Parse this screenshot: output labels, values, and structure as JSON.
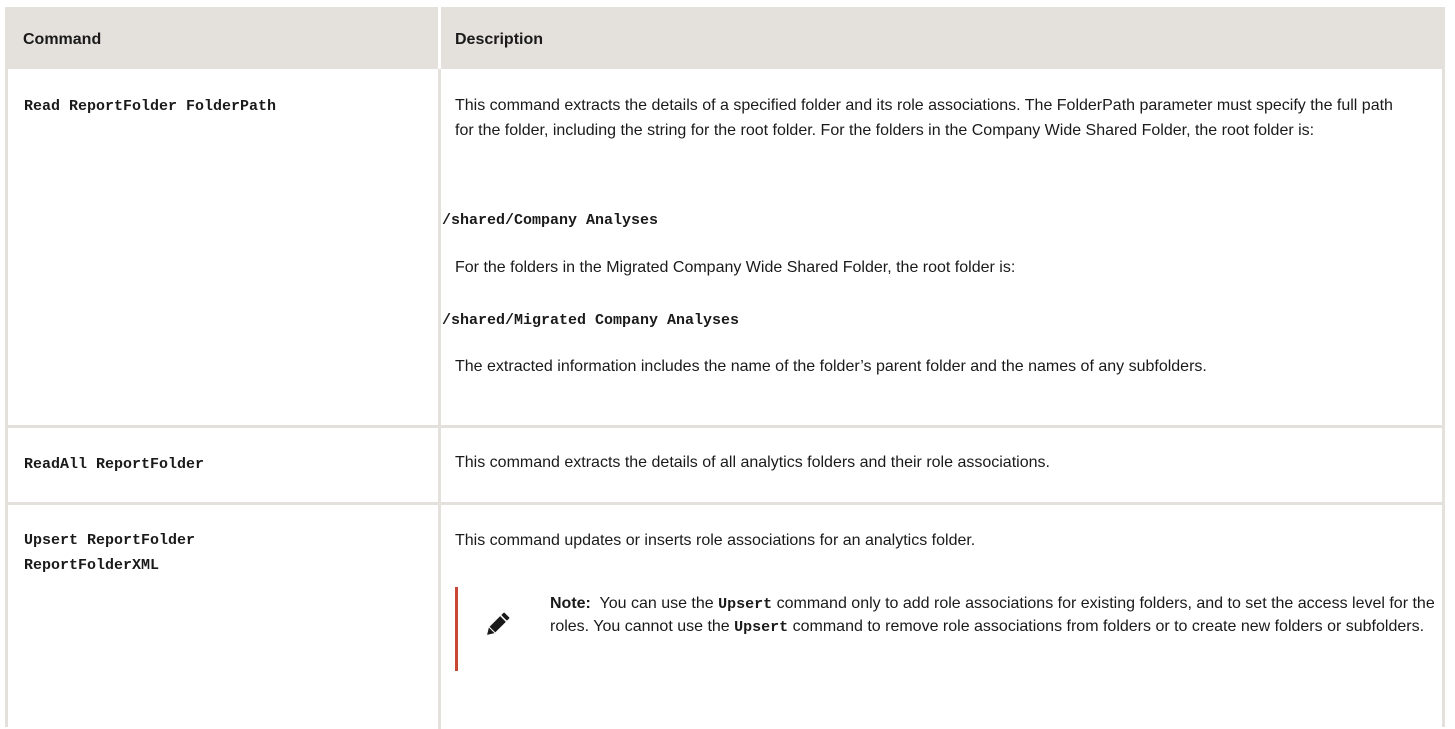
{
  "header": {
    "command": "Command",
    "description": "Description"
  },
  "rows": [
    {
      "command": "Read ReportFolder FolderPath",
      "para1": "This command extracts the details of a specified folder and its role associations. The FolderPath parameter must specify the full path for the folder, including the string for the root folder. For the folders in the Company Wide Shared Folder, the root folder is:",
      "code1": "/shared/Company Analyses",
      "para2": "For the folders in the Migrated Company Wide Shared Folder, the root folder is:",
      "code2": "/shared/Migrated Company Analyses",
      "para3": "The extracted information includes the name of the folder’s parent folder and the names of any subfolders."
    },
    {
      "command": "ReadAll ReportFolder",
      "para1": "This command extracts the details of all analytics folders and their role associations."
    },
    {
      "command": "Upsert ReportFolder ReportFolderXML",
      "para1": "This command updates or inserts role associations for an analytics folder.",
      "note": {
        "label": "Note:",
        "text_a": "You can use the",
        "code_a": "Upsert",
        "text_b": "command only to add role associations for existing folders, and to set the access level for the roles. You cannot use the",
        "code_b": "Upsert",
        "text_c": "command to remove role associations from folders or to create new folders or subfolders.",
        "icon": "pencil-icon"
      }
    }
  ],
  "colors": {
    "header_bg": "#e4e1dc",
    "note_accent": "#c74634"
  }
}
